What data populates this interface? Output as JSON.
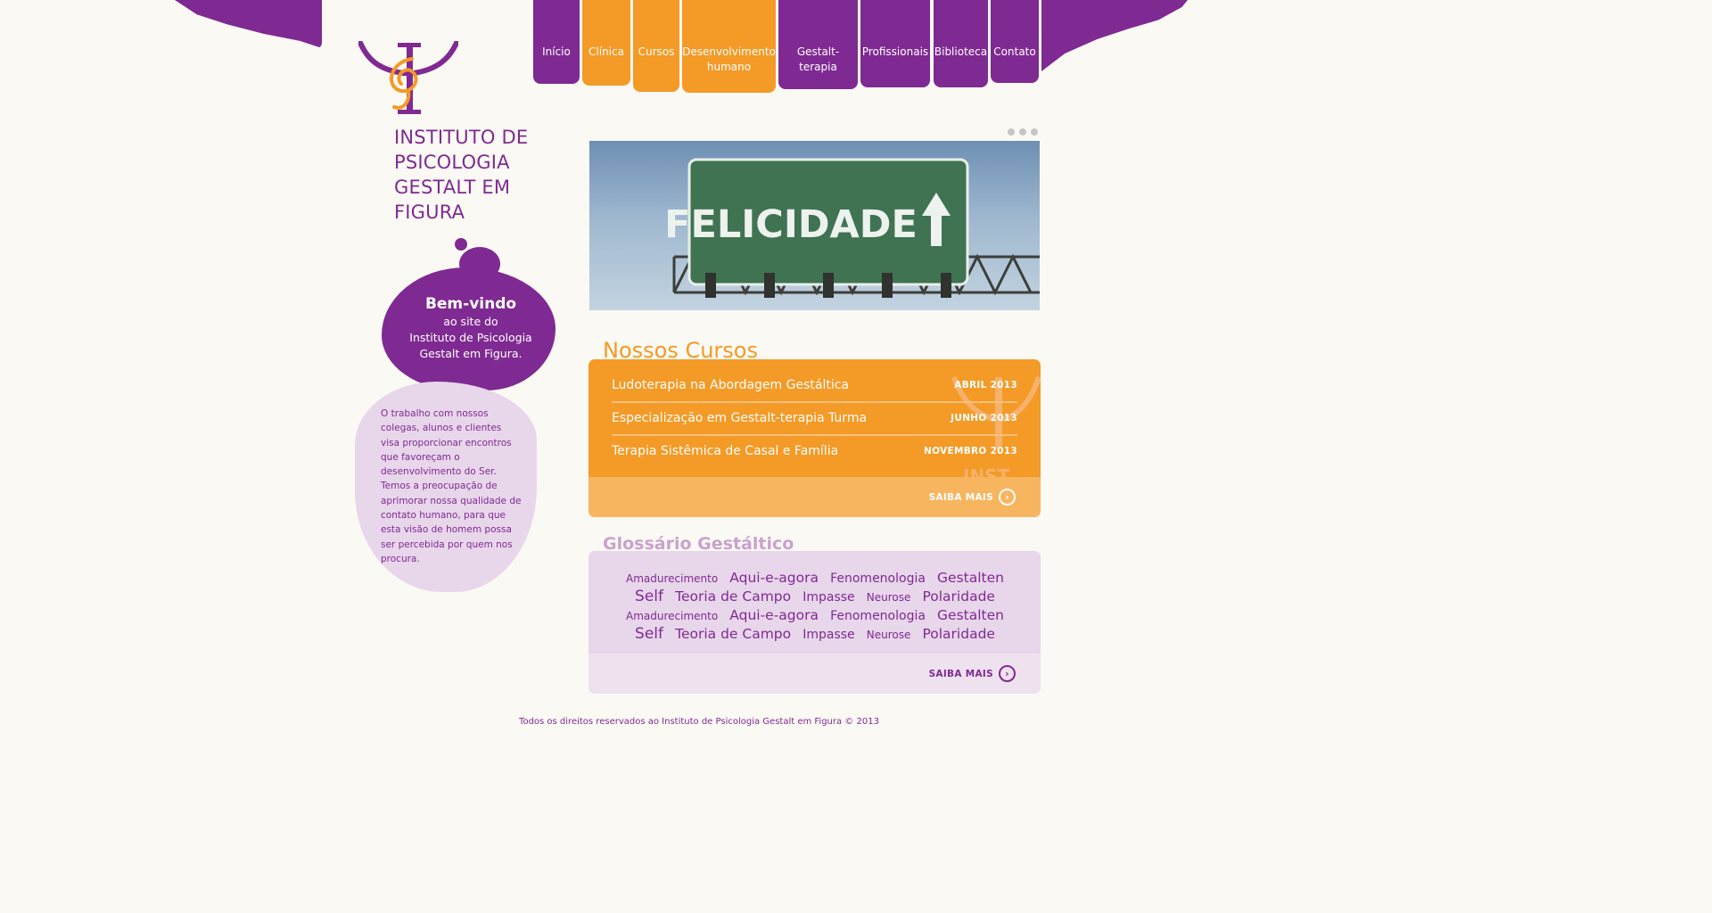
{
  "site": {
    "title": "INSTITUTO DE PSICOLOGIA GESTALT EM FIGURA"
  },
  "nav": [
    {
      "label": "Início",
      "color": "#7f2a92"
    },
    {
      "label": "Clínica",
      "color": "#f49a26"
    },
    {
      "label": "Cursos",
      "color": "#f49a26"
    },
    {
      "label": "Desenvolvimento humano",
      "color": "#f49a26"
    },
    {
      "label": "Gestalt-terapia",
      "color": "#7f2a92"
    },
    {
      "label": "Profissionais",
      "color": "#7f2a92"
    },
    {
      "label": "Biblioteca",
      "color": "#7f2a92"
    },
    {
      "label": "Contato",
      "color": "#7f2a92"
    }
  ],
  "welcome": {
    "title": "Bem-vindo",
    "line1": "ao site do",
    "line2": "Instituto de Psicologia",
    "line3": "Gestalt em Figura."
  },
  "about": {
    "text": "O trabalho com nossos colegas, alunos e clientes visa proporcionar encontros que favoreçam o desenvolvimento do Ser. Temos a preocupação de aprimorar nossa qualidade de contato humano, para que esta visão de homem possa ser percebida por quem nos procura."
  },
  "banner": {
    "sign_text": "FELICIDADE"
  },
  "courses": {
    "title": "Nossos Cursos",
    "items": [
      {
        "name": "Ludoterapia na Abordagem Gestáltica",
        "date": "ABRIL 2013"
      },
      {
        "name": "Especialização em Gestalt-terapia Turma",
        "date": "JUNHO 2013"
      },
      {
        "name": "Terapia Sistêmica de Casal e Família",
        "date": "NOVEMBRO 2013"
      }
    ],
    "more_label": "SAIBA MAIS"
  },
  "glossary": {
    "title": "Glossário Gestáltico",
    "tags": [
      {
        "label": "Amadurecimento",
        "size": "s"
      },
      {
        "label": "Aqui-e-agora",
        "size": "l"
      },
      {
        "label": "Fenomenologia",
        "size": "m"
      },
      {
        "label": "Gestalten",
        "size": "l"
      },
      {
        "label": "Self",
        "size": "xl"
      },
      {
        "label": "Teoria de Campo",
        "size": "l"
      },
      {
        "label": "Impasse",
        "size": "m"
      },
      {
        "label": "Neurose",
        "size": "s"
      },
      {
        "label": "Polaridade",
        "size": "l"
      },
      {
        "label": "Amadurecimento",
        "size": "s"
      },
      {
        "label": "Aqui-e-agora",
        "size": "l"
      },
      {
        "label": "Fenomenologia",
        "size": "m"
      },
      {
        "label": "Gestalten",
        "size": "l"
      },
      {
        "label": "Self",
        "size": "xl"
      },
      {
        "label": "Teoria de Campo",
        "size": "l"
      },
      {
        "label": "Impasse",
        "size": "m"
      },
      {
        "label": "Neurose",
        "size": "s"
      },
      {
        "label": "Polaridade",
        "size": "l"
      }
    ],
    "more_label": "SAIBA MAIS"
  },
  "footer": {
    "text": "Todos os direitos reservados ao Instituto de Psicologia Gestalt em Figura © 2013"
  },
  "colors": {
    "purple": "#7f2a92",
    "orange": "#f49a26",
    "lilac": "#e8d6ea",
    "background": "#fbf9f3"
  }
}
